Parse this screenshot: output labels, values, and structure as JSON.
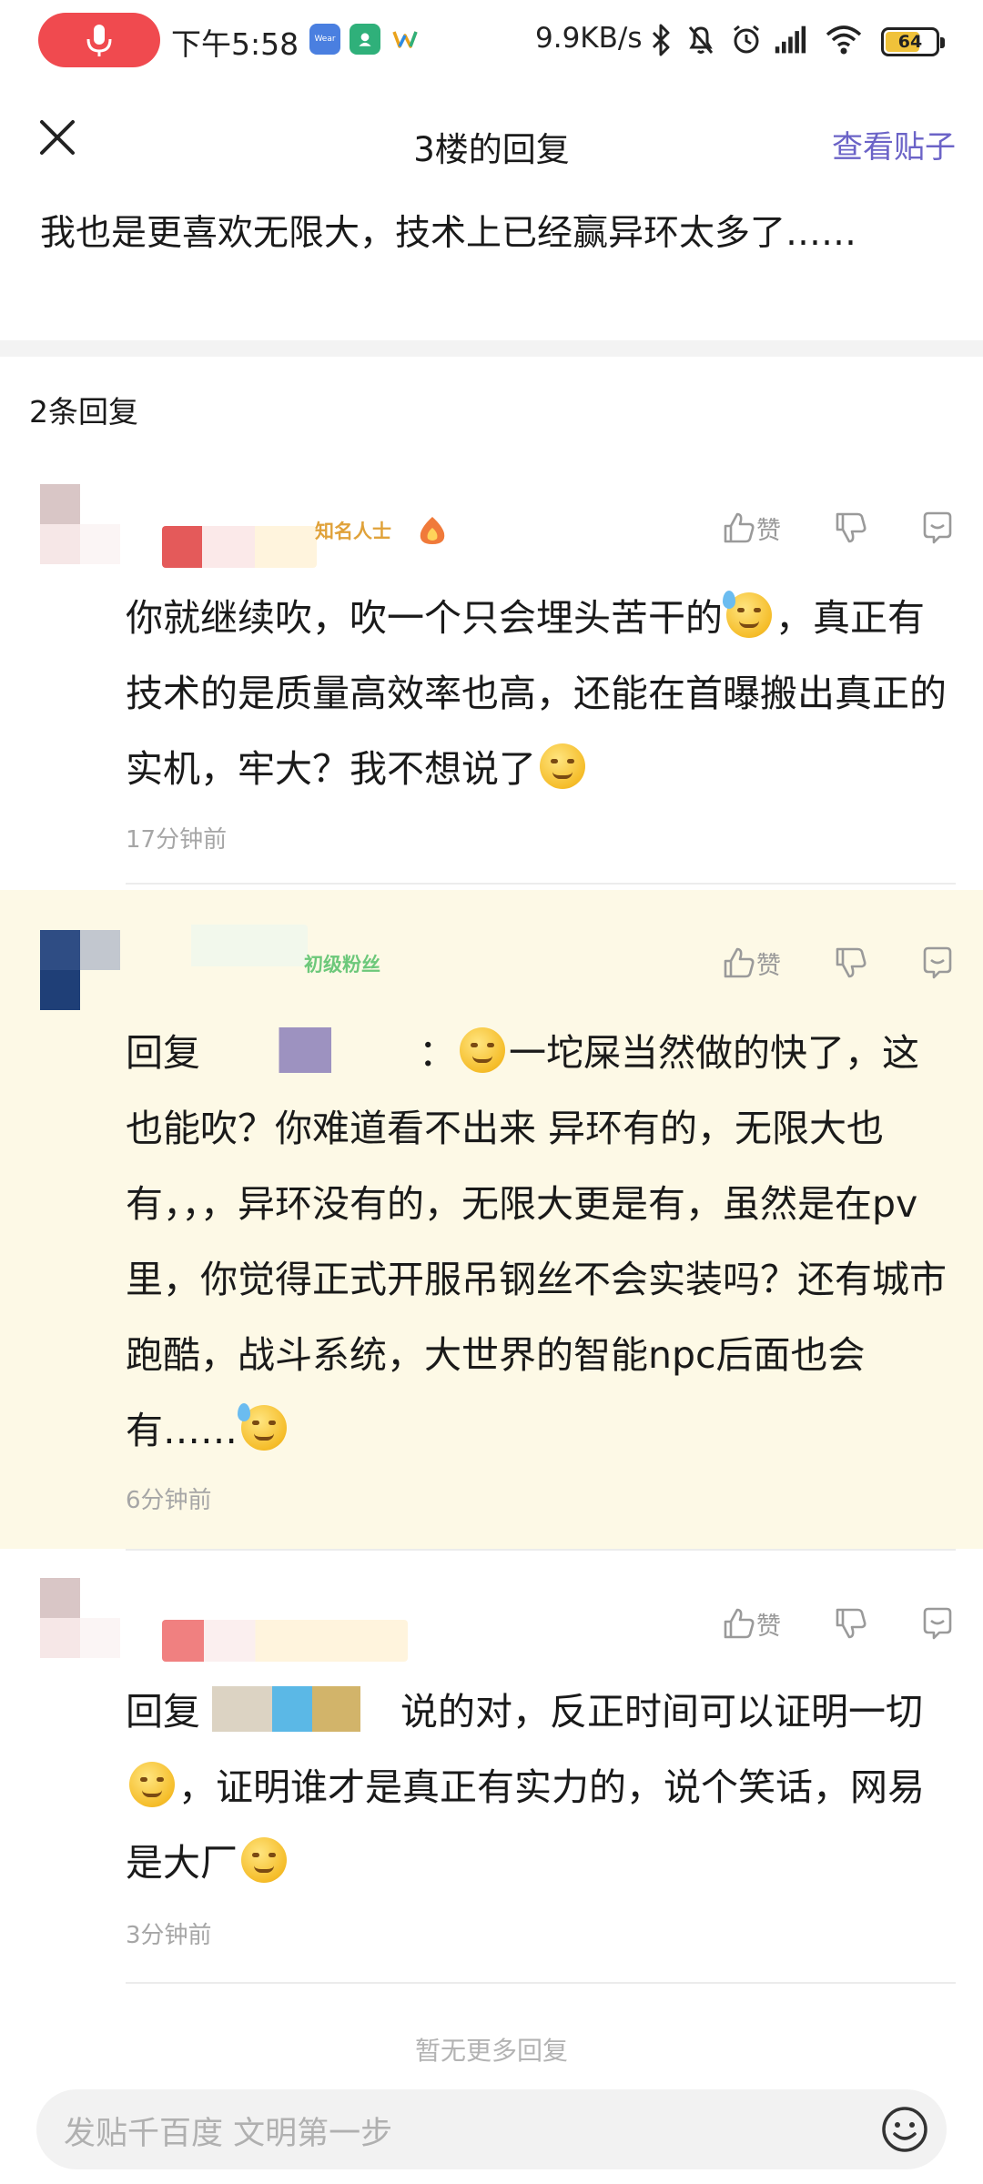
{
  "status_bar": {
    "time": "下午5:58",
    "network_speed": "9.9KB/s",
    "battery_level": "64",
    "battery_fraction": 0.64,
    "app_icons": [
      "Wear"
    ]
  },
  "header": {
    "title": "3楼的回复",
    "view_post_link": "查看贴子"
  },
  "original_post": {
    "text": "我也是更喜欢无限大，技术上已经赢异环太多了……"
  },
  "reply_count": "2条回复",
  "actions": {
    "like_label": "赞"
  },
  "comments": [
    {
      "badge": "知名人士",
      "text_a": "你就继续吹，吹一个只会埋头苦干的",
      "text_b": "，真正有技术的是质量高效率也高，还能在首曝搬出真正的实机，牢大？我不想说了",
      "time": "17分钟前"
    },
    {
      "badge": "初级粉丝",
      "prefix": "回复",
      "text_a": "：",
      "text_b": "一坨屎当然做的快了，这也能吹？你难道看不出来 异环有的，无限大也有，，，异环没有的，无限大更是有，虽然是在pv里，你觉得正式开服吊钢丝不会实装吗？还有城市跑酷，战斗系统，大世界的智能npc后面也会有……",
      "time": "6分钟前"
    },
    {
      "prefix": "回复",
      "text_a": "说的对，反正时间可以证明一切",
      "text_b": "，证明谁才是真正有实力的，说个笑话，网易是大厂",
      "time": "3分钟前"
    }
  ],
  "footer": {
    "no_more": "暂无更多回复",
    "input_placeholder": "发贴千百度 文明第一步"
  },
  "colors": {
    "accent": "#6b63c7",
    "highlight_bg": "#fdf9e6",
    "mic_red": "#f04a4f"
  }
}
